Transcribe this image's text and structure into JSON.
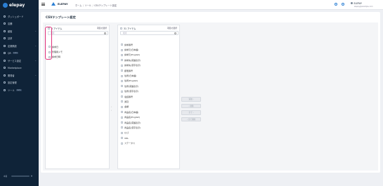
{
  "app": {
    "logo_text": "elepay"
  },
  "sidebar": {
    "items": [
      {
        "label": "ダッシュボード",
        "icon": "dashboard-icon",
        "badge": "",
        "has_chevron": false
      },
      {
        "label": "店舗",
        "icon": "store-icon",
        "badge": "",
        "has_chevron": false
      },
      {
        "label": "顧客",
        "icon": "customers-icon",
        "badge": "",
        "has_chevron": true
      },
      {
        "label": "請求",
        "icon": "invoice-icon",
        "badge": "",
        "has_chevron": false
      },
      {
        "label": "定期購読",
        "icon": "subscription-icon",
        "badge": "",
        "has_chevron": true
      },
      {
        "label": "QR",
        "icon": "qr-icon",
        "badge": "beta",
        "has_chevron": false
      },
      {
        "label": "サービス設定",
        "icon": "service-settings-icon",
        "badge": "",
        "has_chevron": true
      },
      {
        "label": "Marketplace",
        "icon": "marketplace-icon",
        "badge": "",
        "has_chevron": false
      },
      {
        "label": "開発者",
        "icon": "developer-icon",
        "badge": "",
        "has_chevron": true
      },
      {
        "label": "設定管理",
        "icon": "settings-icon",
        "badge": "",
        "has_chevron": false
      },
      {
        "label": "ツール",
        "icon": "tools-icon",
        "badge": "beta",
        "has_chevron": false
      }
    ],
    "footer": {
      "left": "本番",
      "right": "▲"
    }
  },
  "header": {
    "org_name": "ELEPAY",
    "breadcrumb": [
      "ホーム",
      "ツール",
      "CSVテンプレート設定"
    ],
    "user_name": "ELEPAY",
    "user_email": "elepay@example.com"
  },
  "page": {
    "title": "CSVテンプレート設定"
  },
  "left_panel": {
    "header": "0 アイテム",
    "count": "項目の選択",
    "search_placeholder": "検索",
    "items": [
      "請求日",
      "管理用メモ",
      "請求日時"
    ]
  },
  "right_panel": {
    "header": "31 アイテム",
    "count": "項目の選択",
    "search_placeholder": "検索",
    "items": [
      "請求番号",
      "請求元(日本語)",
      "請求元(English)",
      "請求先(英語表示)",
      "請求先(漢字表示)",
      "郵便番号",
      "住所(日本語)",
      "住所(English)",
      "住所(英語表示)",
      "住所(漢字表示)",
      "電話番号",
      "通貨",
      "金額",
      "商品名(日本語)",
      "商品名(English)",
      "商品名(英語表示)",
      "商品名(漢字表示)",
      "ロゴ",
      "URL",
      "ステータス"
    ]
  },
  "actions": [
    "追加 ›",
    "‹ 削除",
    "全て ›",
    "‹ 全て削除"
  ],
  "transfer_arrows": [
    "›",
    "‹"
  ]
}
